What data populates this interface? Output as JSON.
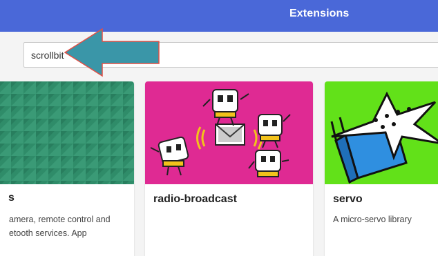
{
  "header": {
    "title": "Extensions"
  },
  "search": {
    "value": "scrollbit"
  },
  "cards": [
    {
      "title": "s",
      "description": "amera, remote control and",
      "description_line2": "etooth services. App",
      "color": "#2e8c6a"
    },
    {
      "title": "radio-broadcast",
      "description": "",
      "color": "#e0218a"
    },
    {
      "title": "servo",
      "description": "A micro-servo library",
      "color": "#63e21a"
    }
  ],
  "colors": {
    "header": "#4a68d8",
    "arrow_fill": "#3a96a8",
    "arrow_outline": "#e15046"
  }
}
